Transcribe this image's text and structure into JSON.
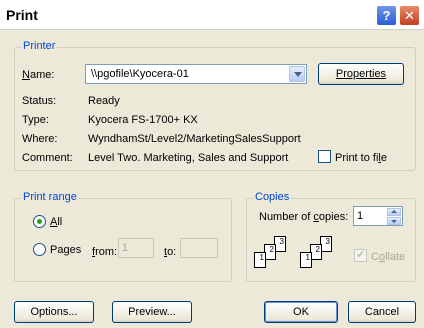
{
  "window": {
    "title": "Print",
    "help_glyph": "?",
    "close_glyph": "✕"
  },
  "printer": {
    "legend": "Printer",
    "name_label": "Name:",
    "name_value": "\\\\pgofile\\Kyocera-01",
    "properties_label": "Properties",
    "status_label": "Status:",
    "status_value": "Ready",
    "type_label": "Type:",
    "type_value": "Kyocera FS-1700+ KX",
    "where_label": "Where:",
    "where_value": "WyndhamSt/Level2/MarketingSalesSupport",
    "comment_label": "Comment:",
    "comment_value": "Level Two. Marketing, Sales and Support",
    "print_to_file_label": "Print to file",
    "print_to_file_checked": false
  },
  "print_range": {
    "legend": "Print range",
    "all_label": "All",
    "all_selected": true,
    "pages_label": "Pages",
    "from_label": "from:",
    "from_value": "1",
    "to_label": "to:",
    "to_value": ""
  },
  "copies": {
    "legend": "Copies",
    "number_label": "Number of copies:",
    "number_value": "1",
    "collate_label": "Collate",
    "collate_checked": true,
    "collate_enabled": false,
    "page_numbers": [
      "1",
      "2",
      "3"
    ]
  },
  "buttons": {
    "options": "Options...",
    "preview": "Preview...",
    "ok": "OK",
    "cancel": "Cancel"
  }
}
